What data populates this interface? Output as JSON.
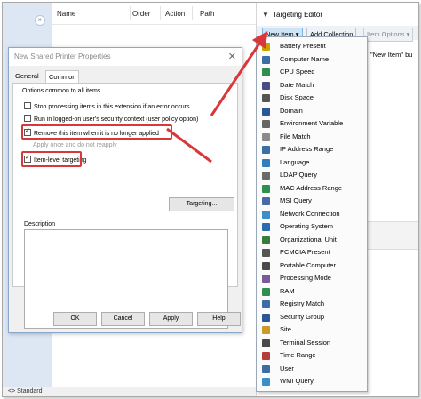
{
  "main_list": {
    "columns": [
      "Name",
      "Order",
      "Action",
      "Path"
    ]
  },
  "bottom_tab": "Standard",
  "dialog": {
    "title": "New Shared Printer Properties",
    "close_glyph": "✕",
    "tabs": [
      "General",
      "Common"
    ],
    "group_title": "Options common to all items",
    "options": [
      {
        "label": "Stop processing items in this extension if an error occurs",
        "checked": false,
        "disabled": false
      },
      {
        "label": "Run in logged-on user's security context (user policy option)",
        "checked": false,
        "disabled": false
      },
      {
        "label": "Remove this item when it is no longer applied",
        "checked": true,
        "disabled": false
      },
      {
        "label": "Apply once and do not reapply",
        "checked": false,
        "disabled": true
      },
      {
        "label": "Item-level targeting",
        "checked": true,
        "disabled": false
      }
    ],
    "targeting_button": "Targeting...",
    "description_label": "Description",
    "buttons": [
      "OK",
      "Cancel",
      "Apply",
      "Help"
    ]
  },
  "targeting_editor": {
    "title": "Targeting Editor",
    "toolbar": {
      "new_item": "New Item ▾",
      "add_collection": "Add Collection",
      "item_options": "Item Options ▾"
    },
    "hint_text": "\"New Item\" bu",
    "menu": [
      {
        "label": "Battery Present",
        "icon": "battery-icon",
        "color": "#c8a400"
      },
      {
        "label": "Computer Name",
        "icon": "computer-icon",
        "color": "#3a6ea5"
      },
      {
        "label": "CPU Speed",
        "icon": "cpu-icon",
        "color": "#2f8f4e"
      },
      {
        "label": "Date Match",
        "icon": "calendar-icon",
        "color": "#4a4a8a"
      },
      {
        "label": "Disk Space",
        "icon": "disk-icon",
        "color": "#555555"
      },
      {
        "label": "Domain",
        "icon": "domain-icon",
        "color": "#2b5797"
      },
      {
        "label": "Environment Variable",
        "icon": "environment-icon",
        "color": "#666666"
      },
      {
        "label": "File Match",
        "icon": "file-icon",
        "color": "#8a8a8a"
      },
      {
        "label": "IP Address Range",
        "icon": "ip-icon",
        "color": "#3a6ea5"
      },
      {
        "label": "Language",
        "icon": "globe-icon",
        "color": "#2f7fbf"
      },
      {
        "label": "LDAP Query",
        "icon": "ldap-icon",
        "color": "#6b6b6b"
      },
      {
        "label": "MAC Address Range",
        "icon": "mac-icon",
        "color": "#2f8f4e"
      },
      {
        "label": "MSI Query",
        "icon": "msi-icon",
        "color": "#4a6aa5"
      },
      {
        "label": "Network Connection",
        "icon": "network-icon",
        "color": "#3a8fc8"
      },
      {
        "label": "Operating System",
        "icon": "os-icon",
        "color": "#2b6cb0"
      },
      {
        "label": "Organizational Unit",
        "icon": "ou-icon",
        "color": "#3a7a3a"
      },
      {
        "label": "PCMCIA Present",
        "icon": "pcmcia-icon",
        "color": "#555555"
      },
      {
        "label": "Portable Computer",
        "icon": "laptop-icon",
        "color": "#4a4a4a"
      },
      {
        "label": "Processing Mode",
        "icon": "processing-icon",
        "color": "#7a5a9a"
      },
      {
        "label": "RAM",
        "icon": "ram-icon",
        "color": "#2f8f4e"
      },
      {
        "label": "Registry Match",
        "icon": "registry-icon",
        "color": "#3a6ea5"
      },
      {
        "label": "Security Group",
        "icon": "security-group-icon",
        "color": "#2b5797"
      },
      {
        "label": "Site",
        "icon": "site-icon",
        "color": "#c89b2a"
      },
      {
        "label": "Terminal Session",
        "icon": "terminal-icon",
        "color": "#4a4a4a"
      },
      {
        "label": "Time Range",
        "icon": "clock-icon",
        "color": "#b83b3b"
      },
      {
        "label": "User",
        "icon": "user-icon",
        "color": "#3a6ea5"
      },
      {
        "label": "WMI Query",
        "icon": "wmi-icon",
        "color": "#3a8fc8"
      }
    ]
  },
  "accent_color": "#d9383a"
}
